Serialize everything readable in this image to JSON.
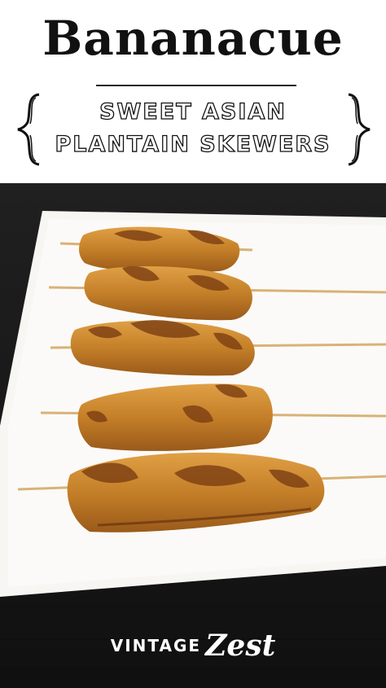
{
  "header": {
    "title": "Bananacue",
    "subtitle_line1": "SWEET ASIAN",
    "subtitle_line2": "PLANTAIN SKEWERS"
  },
  "photo": {
    "subject": "five caramelized plantain skewers on a white plate",
    "skewer_count": 5
  },
  "logo": {
    "word1": "VINTAGE",
    "word2": "Zest"
  },
  "colors": {
    "header_bg": "#ffffff",
    "text_dark": "#111111",
    "background_dark": "#151515",
    "plate": "#f7f6f3",
    "plantain": "#c9822a",
    "caramel": "#7a3d12",
    "skewer": "#d9b277"
  }
}
